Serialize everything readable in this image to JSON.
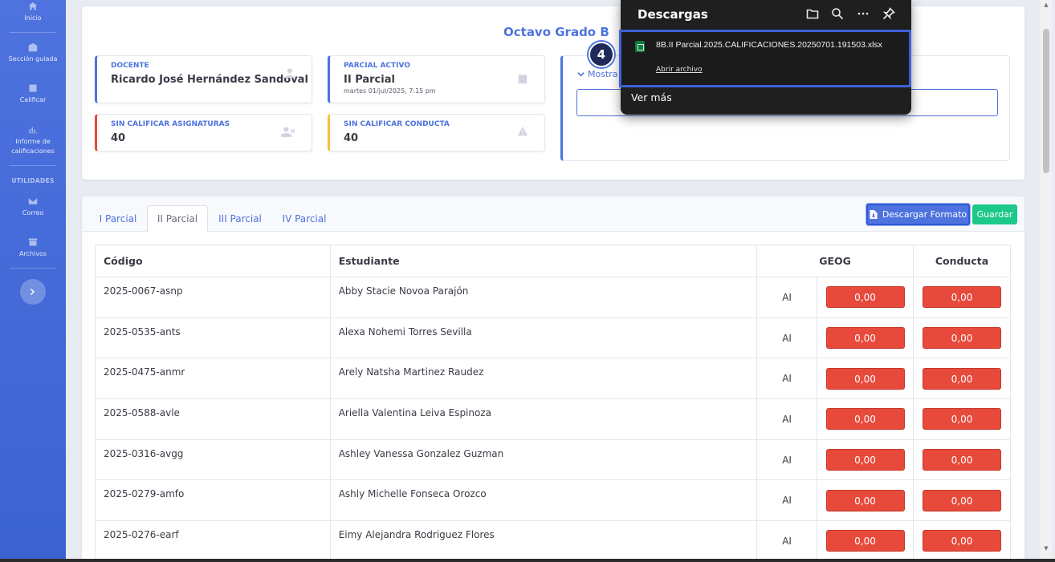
{
  "sidebar": {
    "items": [
      {
        "label": "Inicio",
        "icon": "home-icon"
      },
      {
        "label": "Sección guiada",
        "icon": "building-icon"
      },
      {
        "label": "Calificar",
        "icon": "list-icon"
      },
      {
        "label": "Informe de calificaciones",
        "icon": "chart-icon"
      },
      {
        "label": "Correo",
        "icon": "envelope-icon"
      },
      {
        "label": "Archivos",
        "icon": "archive-icon"
      }
    ],
    "heading_utilities": "UTILIDADES"
  },
  "header": {
    "grade_title": "Octavo Grado B"
  },
  "stats": {
    "docente": {
      "label": "DOCENTE",
      "value": "Ricardo José Hernández Sandoval"
    },
    "parcial": {
      "label": "PARCIAL ACTIVO",
      "value": "II Parcial",
      "sub": "martes 01/jul/2025, 7:15 pm"
    },
    "sin_asig": {
      "label": "SIN CALIFICAR ASIGNATURAS",
      "value": "40"
    },
    "sin_cond": {
      "label": "SIN CALIFICAR CONDUCTA",
      "value": "40"
    }
  },
  "filter": {
    "toggle_label": "Mostra"
  },
  "tabs": [
    "I Parcial",
    "II Parcial",
    "III Parcial",
    "IV Parcial"
  ],
  "toolbar": {
    "download_label": "Descargar Formato",
    "save_label": "Guardar"
  },
  "table": {
    "headers": {
      "code": "Código",
      "student": "Estudiante",
      "subject": "GEOG",
      "conduct": "Conducta"
    },
    "rows": [
      {
        "code": "2025-0067-asnp",
        "student": "Abby Stacie Novoa Parajón",
        "ai": "AI",
        "geog": "0,00",
        "conduct": "0,00"
      },
      {
        "code": "2025-0535-ants",
        "student": "Alexa Nohemi Torres Sevilla",
        "ai": "AI",
        "geog": "0,00",
        "conduct": "0,00"
      },
      {
        "code": "2025-0475-anmr",
        "student": "Arely Natsha Martinez Raudez",
        "ai": "AI",
        "geog": "0,00",
        "conduct": "0,00"
      },
      {
        "code": "2025-0588-avle",
        "student": "Ariella Valentina Leiva Espinoza",
        "ai": "AI",
        "geog": "0,00",
        "conduct": "0,00"
      },
      {
        "code": "2025-0316-avgg",
        "student": "Ashley Vanessa Gonzalez Guzman",
        "ai": "AI",
        "geog": "0,00",
        "conduct": "0,00"
      },
      {
        "code": "2025-0279-amfo",
        "student": "Ashly Michelle Fonseca Orozco",
        "ai": "AI",
        "geog": "0,00",
        "conduct": "0,00"
      },
      {
        "code": "2025-0276-earf",
        "student": "Eimy Alejandra Rodriguez Flores",
        "ai": "AI",
        "geog": "0,00",
        "conduct": "0,00"
      }
    ]
  },
  "downloads": {
    "title": "Descargas",
    "file_name": "8B.II Parcial.2025.CALIFICACIONES.20250701.191503.xlsx",
    "open_label": "Abrir archivo",
    "more_label": "Ver más"
  },
  "step_badge": "4"
}
